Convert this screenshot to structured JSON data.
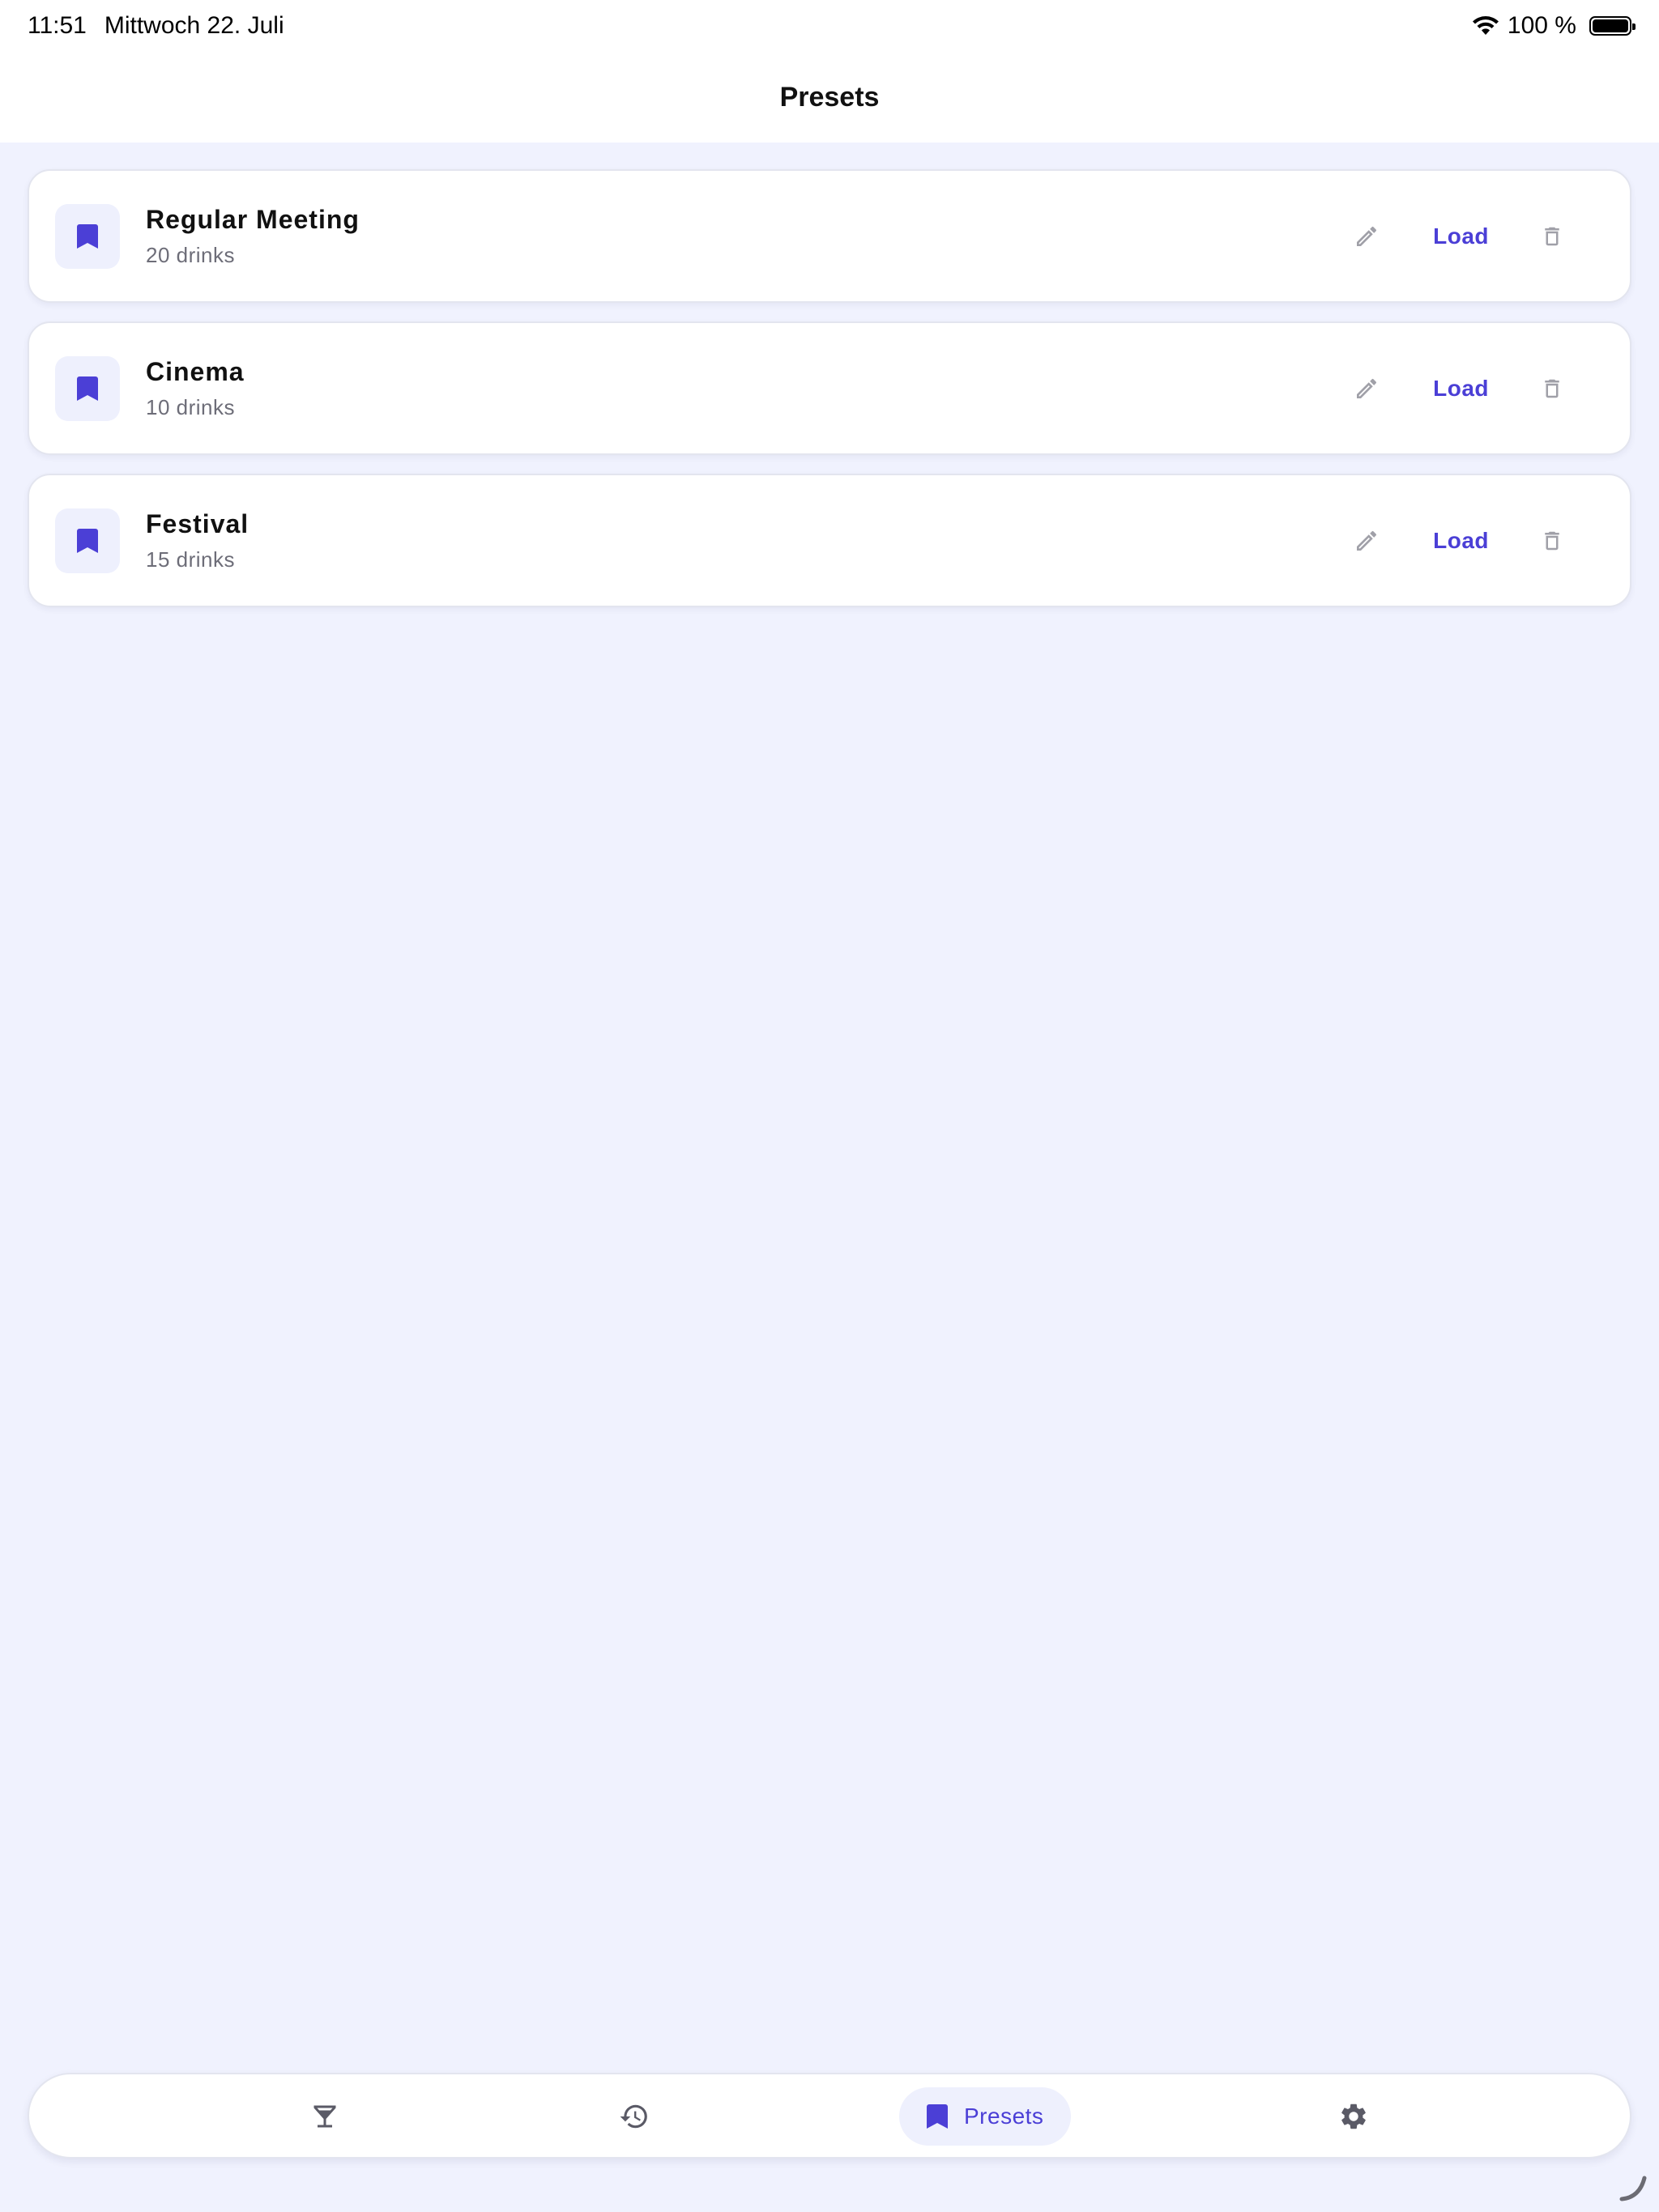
{
  "status": {
    "time": "11:51",
    "date": "Mittwoch 22. Juli",
    "battery": "100 %"
  },
  "header": {
    "title": "Presets"
  },
  "presets": [
    {
      "name": "Regular Meeting",
      "subtitle": "20 drinks",
      "load_label": "Load"
    },
    {
      "name": "Cinema",
      "subtitle": "10 drinks",
      "load_label": "Load"
    },
    {
      "name": "Festival",
      "subtitle": "15 drinks",
      "load_label": "Load"
    }
  ],
  "tabbar": {
    "tabs": [
      {
        "icon": "cocktail-icon"
      },
      {
        "icon": "history-icon"
      },
      {
        "icon": "bookmark-icon",
        "label": "Presets",
        "active": true
      },
      {
        "icon": "gear-icon"
      }
    ]
  },
  "colors": {
    "accent": "#4b3fd6",
    "background": "#f0f2fe",
    "icon_tile": "#eef0fd",
    "muted_icon": "#a0a0a8"
  }
}
